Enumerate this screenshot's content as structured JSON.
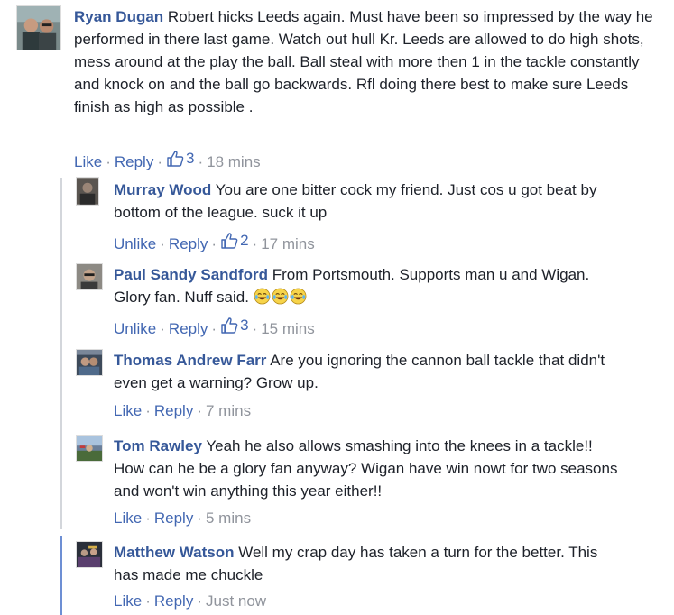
{
  "comments": [
    {
      "name": "Ryan Dugan",
      "text": " Robert hicks Leeds again. Must have been so impressed by the way he performed in there last game. Watch out hull Kr. Leeds are allowed to do high shots, mess around at the play the ball. Ball steal with more then 1 in the tackle constantly and knock on and the ball go backwards. Rfl doing there best to make sure Leeds finish as high as possible .",
      "like_label": "Like",
      "reply_label": "Reply",
      "like_count": "3",
      "time": "18 mins"
    }
  ],
  "replies": [
    {
      "name": "Murray Wood",
      "text": " You are one bitter cock my friend. Just cos u got beat by bottom of the league. suck it up",
      "like_label": "Unlike",
      "reply_label": "Reply",
      "like_count": "2",
      "time": "17 mins"
    },
    {
      "name": "Paul Sandy Sandford",
      "text": " From Portsmouth. Supports man u and Wigan. Glory fan. Nuff said. ",
      "emoji_icon": "tears-of-joy-emoji-icon",
      "like_label": "Unlike",
      "reply_label": "Reply",
      "like_count": "3",
      "time": "15 mins"
    },
    {
      "name": "Thomas Andrew Farr",
      "text": " Are you ignoring the cannon ball tackle that didn't even get a warning? Grow up.",
      "like_label": "Like",
      "reply_label": "Reply",
      "time": "7 mins"
    },
    {
      "name": "Tom Rawley",
      "text": " Yeah he also allows smashing into the knees in a tackle!! How can he be a glory fan anyway? Wigan have win nowt for two seasons and won't win anything this year either!!",
      "like_label": "Like",
      "reply_label": "Reply",
      "time": "5 mins"
    },
    {
      "name": "Matthew Watson",
      "text": " Well my crap day has taken a turn for the better. This has made me chuckle",
      "like_label": "Like",
      "reply_label": "Reply",
      "time": "Just now"
    }
  ],
  "colors": {
    "name": "#365899",
    "link": "#4267b2",
    "meta": "#90949c",
    "reply_line": "#d3d6db",
    "reply_line_active": "#6d8fd4"
  },
  "icons": {
    "thumbs_up": "thumbs-up-icon"
  }
}
